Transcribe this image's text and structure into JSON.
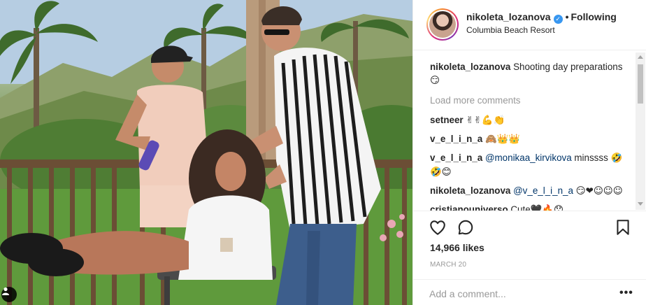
{
  "header": {
    "username": "nikoleta_lozanova",
    "separator": "•",
    "follow_label": "Following",
    "location": "Columbia Beach Resort"
  },
  "comments": {
    "caption": {
      "user": "nikoleta_lozanova",
      "text": "Shooting day preparations",
      "emoji": "😏"
    },
    "load_more": "Load more comments",
    "items": [
      {
        "user": "setneer",
        "text": "",
        "emoji": "✌✌💪👏"
      },
      {
        "user": "v_e_l_i_n_a",
        "text": "",
        "emoji": "🙈👑👑"
      },
      {
        "user": "v_e_l_i_n_a",
        "mention": "@monikaa_kirvikova",
        "text": " minssss",
        "emoji": "🤣🤣😊"
      },
      {
        "user": "nikoleta_lozanova",
        "mention": "@v_e_l_i_n_a",
        "text": "",
        "emoji": "😏❤☺☺☺"
      },
      {
        "user": "cristianouniverso",
        "text": "Cute",
        "emoji": "🖤🔥😯"
      }
    ]
  },
  "post": {
    "likes": "14,966 likes",
    "date": "MARCH 20",
    "comment_placeholder": "Add a comment...",
    "more_label": "•••"
  },
  "icons": {
    "like": "heart-icon",
    "comment": "comment-bubble-icon",
    "save": "bookmark-icon",
    "tag": "user-tag-icon",
    "verified": "verified-badge-icon"
  },
  "colors": {
    "verified": "#3897f0",
    "mention": "#003569",
    "muted": "#999999",
    "text": "#262626",
    "border": "#efefef"
  }
}
